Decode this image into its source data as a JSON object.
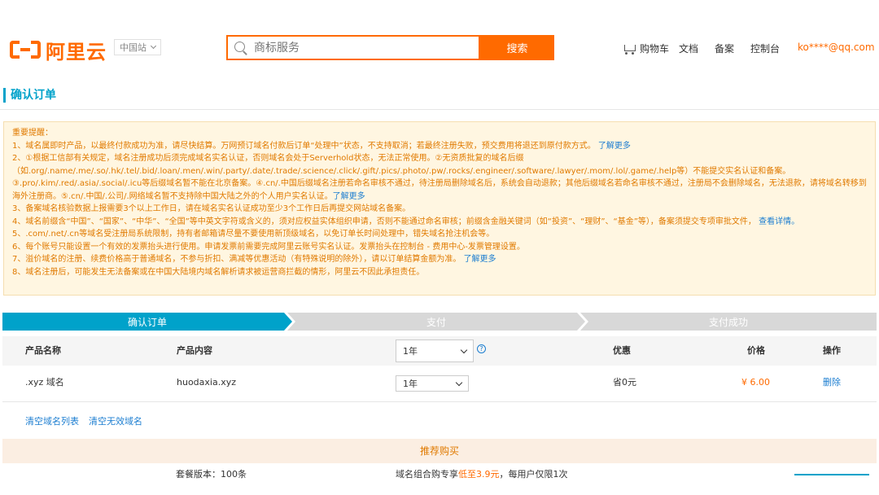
{
  "header": {
    "logo_text": "阿里云",
    "region": "中国站",
    "search_placeholder": "商标服务",
    "search_button": "搜索",
    "nav": {
      "cart": "购物车",
      "docs": "文档",
      "filing": "备案",
      "console": "控制台",
      "user": "ko****@qq.com"
    }
  },
  "page_title": "确认订单",
  "notice": {
    "heading": "重要提醒：",
    "items": [
      {
        "text": "1、域名属即时产品，以最终付款成功为准，请尽快结算。万网预订域名付款后订单“处理中”状态，不支持取消；若最终注册失败，预交费用将退还到原付款方式。",
        "link": "了解更多"
      },
      {
        "text": "2、①根据工信部有关规定，域名注册成功后须完成域名实名认证，否则域名会处于Serverhold状态，无法正常使用。②无资质批复的域名后缀（如.org/.name/.me/.so/.hk/.tel/.bid/.loan/.men/.win/.party/.date/.trade/.science/.click/.gift/.pics/.photo/.pw/.rocks/.engineer/.software/.lawyer/.mom/.lol/.game/.help等）不能提交实名认证和备案。③.pro/.kim/.red/.asia/.social/.icu等后缀域名暂不能在北京备案。④.cn/.中国后缀域名注册若命名审核不通过，待注册局删除域名后，系统会自动退款；其他后缀域名若命名审核不通过，注册局不会删除域名，无法退款，请将域名转移到海外注册商。⑤.cn/.中国/.公司/.网络域名暂不支持除中国大陆之外的个人用户实名认证。",
        "link": "了解更多"
      },
      {
        "text": "3、备案域名核验数据上报需要3个以上工作日，请在域名实名认证成功至少3个工作日后再提交网站域名备案。",
        "link": ""
      },
      {
        "text": "4、域名前缀含“中国”、“国家”、“中华”、“全国”等中英文字符或含义的，须对应权益实体组织申请，否则不能通过命名审核；前缀含金融关键词（如“投资”、“理财”、“基金”等），备案须提交专项审批文件，",
        "link": "查看详情。"
      },
      {
        "text": "5、.com/.net/.cn等域名受注册局系统限制，持有者邮箱请尽量不要使用新顶级域名，以免订单长时间处理中，错失域名抢注机会等。",
        "link": ""
      },
      {
        "text": "6、每个账号只能设置一个有效的发票抬头进行使用。申请发票前需要完成阿里云账号实名认证。发票抬头在控制台 - 费用中心-发票管理设置。",
        "link": ""
      },
      {
        "text": "7、溢价域名的注册、续费价格高于普通域名，不参与折扣、满减等优惠活动（有特殊说明的除外），请以订单结算金额为准。",
        "link": "了解更多"
      },
      {
        "text": "8、域名注册后，可能发生无法备案或在中国大陆境内域名解析请求被运营商拦截的情形，阿里云不因此承担责任。",
        "link": ""
      }
    ]
  },
  "steps": [
    "确认订单",
    "支付",
    "支付成功"
  ],
  "table": {
    "headers": {
      "name": "产品名称",
      "content": "产品内容",
      "duration": "1年",
      "discount": "优惠",
      "price": "价格",
      "action": "操作"
    },
    "rows": [
      {
        "name": ".xyz 域名",
        "content": "huodaxia.xyz",
        "duration": "1年",
        "discount": "省0元",
        "price": "¥ 6.00",
        "action": "删除"
      }
    ]
  },
  "links": {
    "clear_list": "清空域名列表",
    "clear_invalid": "清空无效域名"
  },
  "recommend": {
    "title": "推荐购买",
    "row_left": "套餐版本：100条",
    "row_mid_a": "域名组合购专享",
    "row_mid_hl": "低至3.9元",
    "row_mid_b": "，每用户仅限1次"
  },
  "colors": {
    "brand": "#ff6a00",
    "accent": "#00a2ca",
    "link": "#1b7dd0"
  }
}
